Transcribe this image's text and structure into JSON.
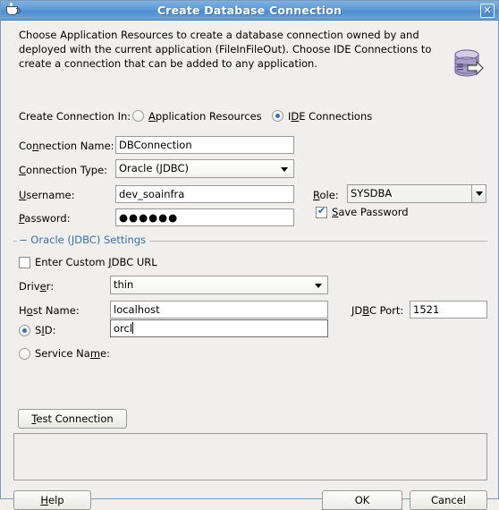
{
  "window": {
    "title": "Create Database Connection",
    "app_icon": "java-coffee-cup-icon",
    "close_label": "✕"
  },
  "header": {
    "description": "Choose Application Resources to create a database connection owned by and deployed with the current application (FileInFileOut). Choose IDE Connections to create a connection that can be added to any application.",
    "icon": "database-connection-icon"
  },
  "create_connection_in": {
    "label": "Create Connection In:",
    "label_mnemonic": "",
    "options": [
      {
        "label": "Application Resources",
        "mnemonic": "A",
        "selected": false
      },
      {
        "label": "IDE Connections",
        "mnemonic": "D",
        "selected": true
      }
    ]
  },
  "form": {
    "connection_name": {
      "label": "Connection Name:",
      "mnemonic": "n",
      "value": "DBConnection"
    },
    "connection_type": {
      "label": "Connection Type:",
      "mnemonic": "C",
      "value": "Oracle (JDBC)"
    },
    "username": {
      "label": "Username:",
      "mnemonic": "U",
      "value": "dev_soainfra"
    },
    "role": {
      "label": "Role:",
      "mnemonic": "R",
      "value": "SYSDBA"
    },
    "password": {
      "label": "Password:",
      "mnemonic": "P",
      "value": "●●●●●●"
    },
    "save_password": {
      "label": "Save Password",
      "mnemonic": "S",
      "checked": true
    }
  },
  "oracle_settings": {
    "title": "Oracle (JDBC) Settings",
    "collapse_marker": "−",
    "custom_url": {
      "label": "Enter Custom JDBC URL",
      "mnemonic": "J",
      "checked": false
    },
    "driver": {
      "label": "Driver:",
      "mnemonic": "e",
      "value": "thin"
    },
    "host_name": {
      "label": "Host Name:",
      "mnemonic": "o",
      "value": "localhost"
    },
    "jdbc_port": {
      "label": "JDBC Port:",
      "mnemonic": "B",
      "value": "1521"
    },
    "sid": {
      "label": "SID:",
      "mnemonic": "I",
      "value": "orcl",
      "selected": true
    },
    "service_name": {
      "label": "Service Name:",
      "mnemonic": "m",
      "value": "",
      "selected": false
    }
  },
  "actions": {
    "test_connection": {
      "label": "Test Connection",
      "mnemonic": "T"
    },
    "output": "",
    "help": {
      "label": "Help",
      "mnemonic": "H"
    },
    "ok": {
      "label": "OK",
      "is_default": true
    },
    "cancel": {
      "label": "Cancel"
    }
  },
  "colors": {
    "titlebar_blue": "#5d9ad6",
    "group_title_blue": "#3b6ea5",
    "accent_blue": "#3a6fc4",
    "dialog_bg": "#f0efed",
    "db_icon_purple": "#9e95c4"
  }
}
